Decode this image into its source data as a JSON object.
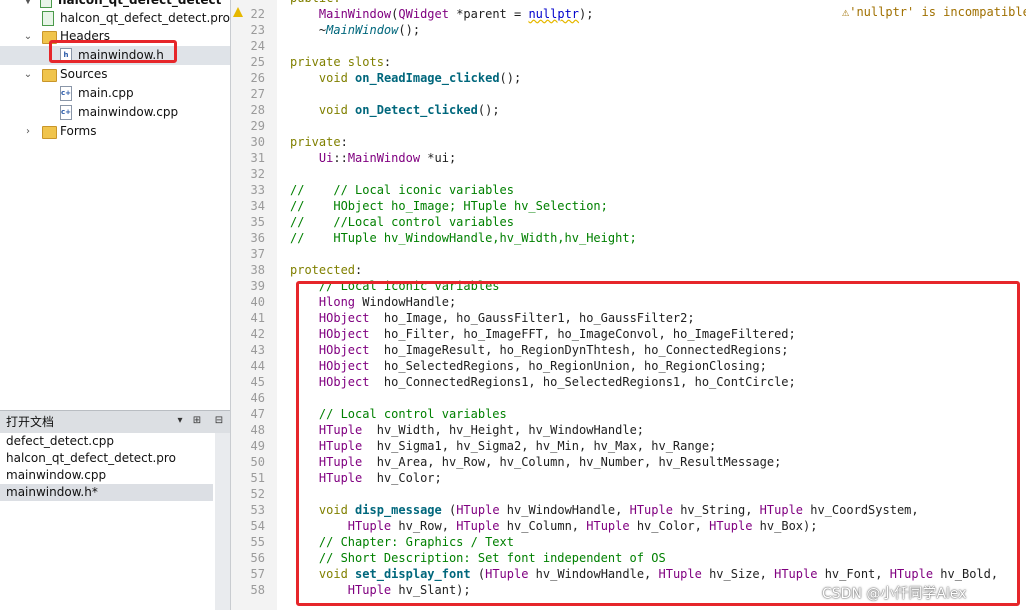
{
  "project_tree": {
    "project_name": "halcon_qt_defect_detect",
    "items": [
      {
        "label": "halcon_qt_defect_detect.pro",
        "kind": "pro-file"
      },
      {
        "label": "Headers",
        "kind": "folder",
        "expanded": true
      },
      {
        "label": "mainwindow.h",
        "kind": "header-file",
        "selected": true
      },
      {
        "label": "Sources",
        "kind": "folder",
        "expanded": true
      },
      {
        "label": "main.cpp",
        "kind": "cpp-file"
      },
      {
        "label": "mainwindow.cpp",
        "kind": "cpp-file"
      },
      {
        "label": "Forms",
        "kind": "folder",
        "expanded": false
      }
    ]
  },
  "open_documents": {
    "title": "打开文档",
    "items": [
      {
        "label": "defect_detect.cpp"
      },
      {
        "label": "halcon_qt_defect_detect.pro"
      },
      {
        "label": "mainwindow.cpp"
      },
      {
        "label": "mainwindow.h*",
        "selected": true
      }
    ]
  },
  "editor": {
    "warning_message": "⚠'nullptr' is incompatible",
    "first_line": 22,
    "lines": [
      "    MainWindow(QWidget *parent = nullptr);",
      "    ~MainWindow();",
      "",
      "private slots:",
      "    void on_ReadImage_clicked();",
      "",
      "    void on_Detect_clicked();",
      "",
      "private:",
      "    Ui::MainWindow *ui;",
      "",
      "//    // Local iconic variables",
      "//    HObject ho_Image; HTuple hv_Selection;",
      "//    //Local control variables",
      "//    HTuple hv_WindowHandle,hv_Width,hv_Height;",
      "",
      "protected:",
      "    // Local iconic variables",
      "    Hlong WindowHandle;",
      "    HObject  ho_Image, ho_GaussFilter1, ho_GaussFilter2;",
      "    HObject  ho_Filter, ho_ImageFFT, ho_ImageConvol, ho_ImageFiltered;",
      "    HObject  ho_ImageResult, ho_RegionDynThtesh, ho_ConnectedRegions;",
      "    HObject  ho_SelectedRegions, ho_RegionUnion, ho_RegionClosing;",
      "    HObject  ho_ConnectedRegions1, ho_SelectedRegions1, ho_ContCircle;",
      "",
      "    // Local control variables",
      "    HTuple  hv_Width, hv_Height, hv_WindowHandle;",
      "    HTuple  hv_Sigma1, hv_Sigma2, hv_Min, hv_Max, hv_Range;",
      "    HTuple  hv_Area, hv_Row, hv_Column, hv_Number, hv_ResultMessage;",
      "    HTuple  hv_Color;",
      "",
      "    void disp_message (HTuple hv_WindowHandle, HTuple hv_String, HTuple hv_CoordSystem,",
      "        HTuple hv_Row, HTuple hv_Column, HTuple hv_Color, HTuple hv_Box);",
      "    // Chapter: Graphics / Text",
      "    // Short Description: Set font independent of OS",
      "    void set_display_font (HTuple hv_WindowHandle, HTuple hv_Size, HTuple hv_Font, HTuple hv_Bold,",
      "        HTuple hv_Slant);"
    ]
  },
  "watermark": "CSDN @小仟同学Alex",
  "colors": {
    "highlight_box": "#e6262a",
    "keyword": "#808000",
    "type": "#800080",
    "function": "#00677c",
    "comment": "#008000"
  }
}
